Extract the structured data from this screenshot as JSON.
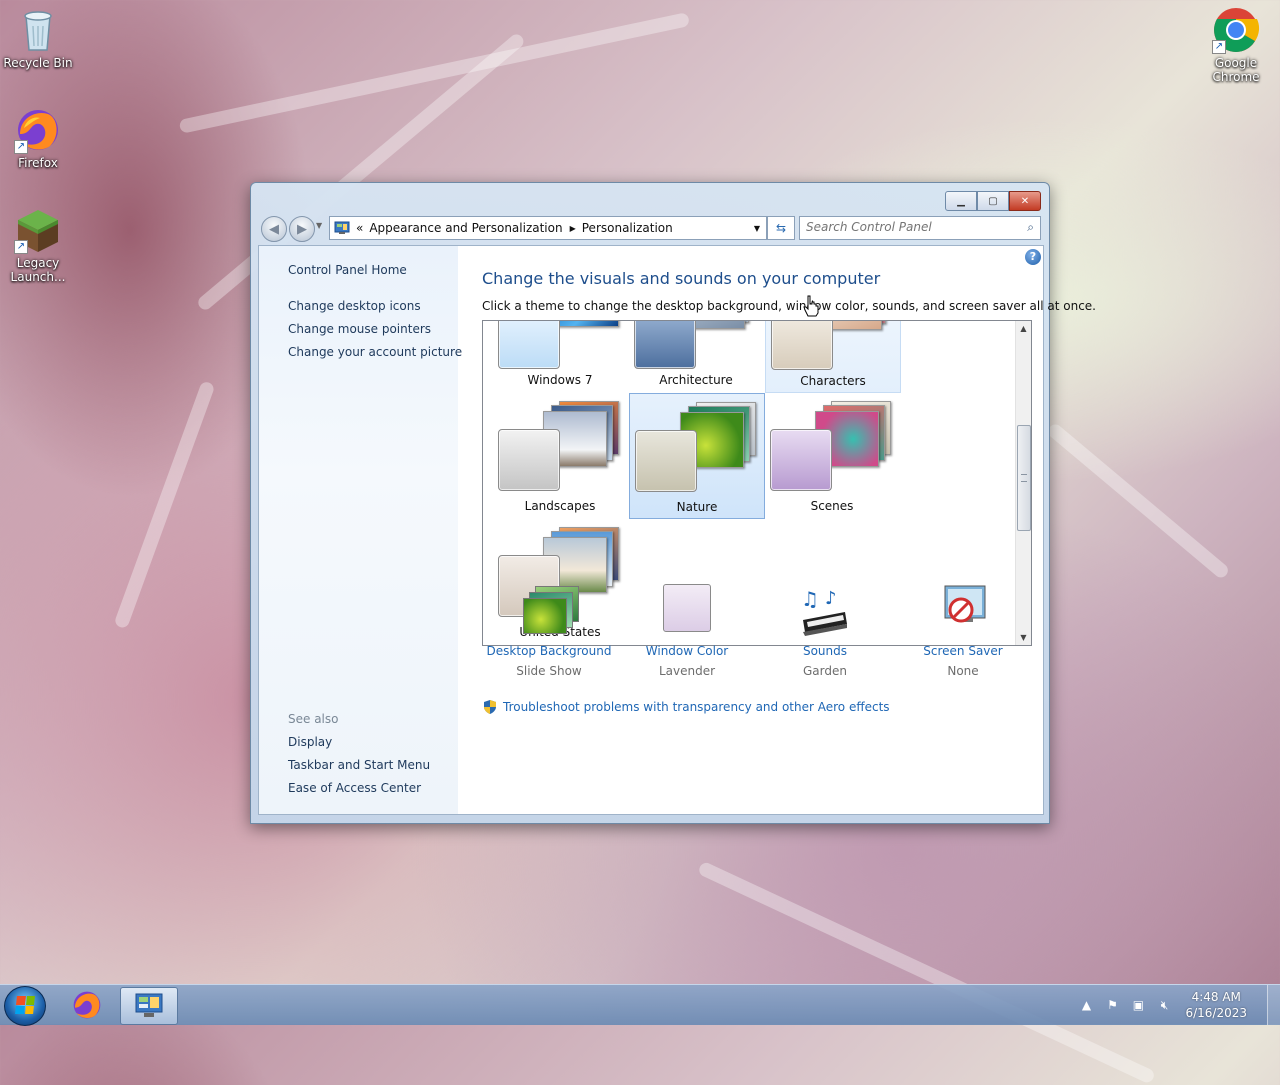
{
  "desktop": {
    "icons": [
      {
        "label": "Recycle Bin"
      },
      {
        "label": "Firefox"
      },
      {
        "label": "Legacy Launch..."
      },
      {
        "label": "Google Chrome"
      }
    ]
  },
  "window": {
    "address": {
      "overflow": "«",
      "crumbs": [
        "Appearance and Personalization",
        "Personalization"
      ]
    },
    "search": {
      "placeholder": "Search Control Panel"
    },
    "left_pane": {
      "home": "Control Panel Home",
      "tasks": [
        "Change desktop icons",
        "Change mouse pointers",
        "Change your account picture"
      ],
      "see_also_title": "See also",
      "see_also": [
        "Display",
        "Taskbar and Start Menu",
        "Ease of Access Center"
      ]
    },
    "heading": "Change the visuals and sounds on your computer",
    "subtext": "Click a theme to change the desktop background, window color, sounds, and screen saver all at once.",
    "themes": [
      {
        "name": "Windows 7"
      },
      {
        "name": "Architecture"
      },
      {
        "name": "Characters"
      },
      {
        "name": "Landscapes"
      },
      {
        "name": "Nature",
        "selected": true
      },
      {
        "name": "Scenes"
      },
      {
        "name": "United States"
      }
    ],
    "bottom": [
      {
        "label": "Desktop Background",
        "value": "Slide Show",
        "icon": "desktop-background-icon"
      },
      {
        "label": "Window Color",
        "value": "Lavender",
        "icon": "window-color-icon"
      },
      {
        "label": "Sounds",
        "value": "Garden",
        "icon": "sounds-icon"
      },
      {
        "label": "Screen Saver",
        "value": "None",
        "icon": "screen-saver-icon"
      }
    ],
    "troubleshoot": "Troubleshoot problems with transparency and other Aero effects"
  },
  "taskbar": {
    "clock": {
      "time": "4:48 AM",
      "date": "6/16/2023"
    }
  }
}
